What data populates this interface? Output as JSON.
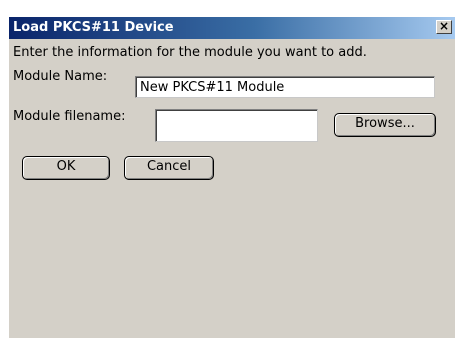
{
  "dialog": {
    "title": "Load PKCS#11 Device",
    "close_glyph": "×",
    "instruction": "Enter the information for the module you want to add."
  },
  "form": {
    "module_name_label": "Module Name:",
    "module_name_value": "New PKCS#11 Module",
    "module_filename_label": "Module filename:",
    "module_filename_value": "",
    "browse_label": "Browse..."
  },
  "buttons": {
    "ok_label": "OK",
    "cancel_label": "Cancel"
  },
  "icons": {
    "close": "close-icon"
  },
  "colors": {
    "titlebar_start": "#0a246a",
    "titlebar_end": "#a6caf0",
    "dialog_background": "#d4d0c8"
  }
}
